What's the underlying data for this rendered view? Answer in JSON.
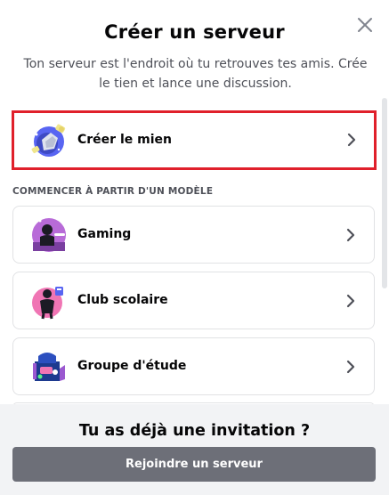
{
  "modal": {
    "title": "Créer un serveur",
    "subtitle": "Ton serveur est l'endroit où tu retrouves tes amis. Crée le tien et lance une discussion.",
    "close_icon": "close-icon"
  },
  "create_own": {
    "label": "Créer le mien",
    "icon": "create-server-icon"
  },
  "templates": {
    "section_title": "COMMENCER À PARTIR D'UN MODÈLE",
    "items": [
      {
        "label": "Gaming",
        "icon": "gaming-icon"
      },
      {
        "label": "Club scolaire",
        "icon": "school-club-icon"
      },
      {
        "label": "Groupe d'étude",
        "icon": "study-group-icon"
      }
    ]
  },
  "footer": {
    "title": "Tu as déjà une invitation ?",
    "join_label": "Rejoindre un serveur"
  },
  "colors": {
    "highlight": "#e0202b",
    "button": "#6d6f78",
    "footer_bg": "#f2f3f5"
  }
}
